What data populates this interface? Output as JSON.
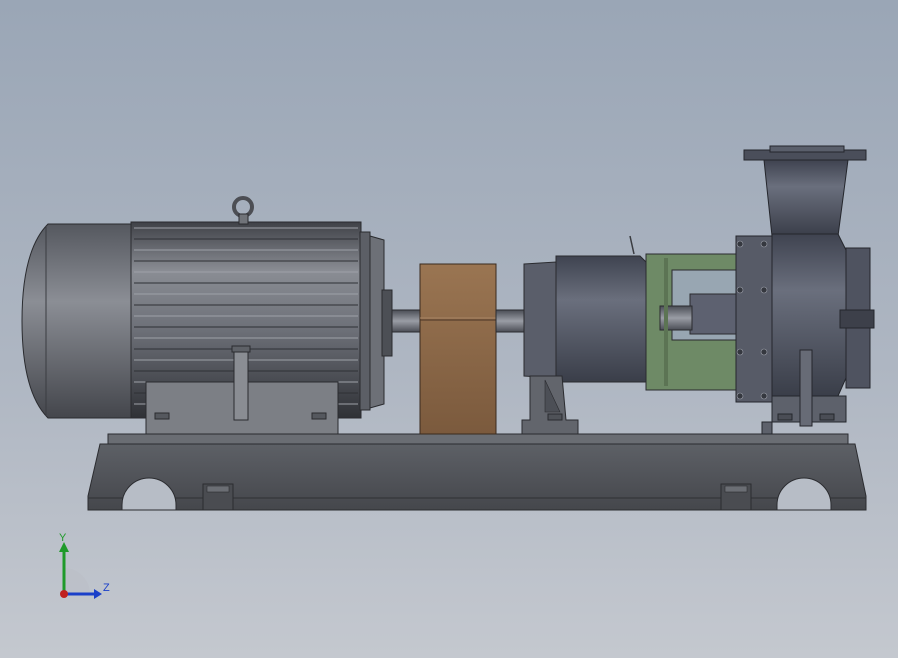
{
  "triad": {
    "y_label": "Y",
    "z_label": "Z",
    "y_color": "#1f9a2a",
    "z_color": "#1a3fc9",
    "x_color": "#c02020"
  },
  "colors": {
    "motor": "#6a6d75",
    "motor_dark": "#3c3e44",
    "pump_casing": "#595e6c",
    "bearing_frame": "#6f8a66",
    "coupling_guard": "#8c6a4c",
    "base": "#54565c",
    "background_top": "#9aa6b6",
    "background_bottom": "#c4c8cf"
  },
  "icons": [
    "motor-icon",
    "pump-icon",
    "coupling-guard-icon",
    "baseplate-icon",
    "triad-icon"
  ]
}
